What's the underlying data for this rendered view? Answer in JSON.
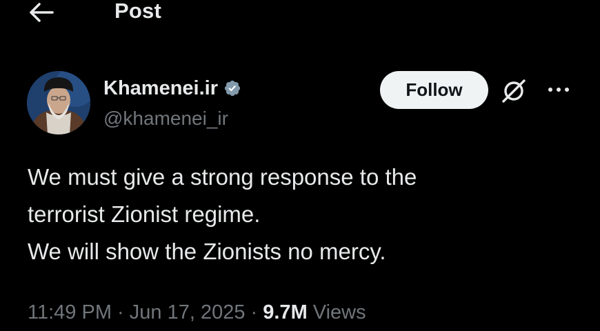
{
  "header": {
    "back_icon": "arrow-left-icon",
    "title": "Post"
  },
  "author": {
    "display_name": "Khamenei.ir",
    "handle": "@khamenei_ir",
    "verified_icon": "verified-badge-icon",
    "verified_color": "#829aab",
    "avatar": "user-avatar"
  },
  "actions": {
    "follow_label": "Follow",
    "grok_icon": "grok-icon",
    "more_icon": "more-dots-icon"
  },
  "tweet": {
    "lines": [
      "We must give a strong response to the",
      "terrorist Zionist regime.",
      "We will show the Zionists no mercy."
    ]
  },
  "meta": {
    "time": "11:49 PM",
    "separator": " · ",
    "date": "Jun 17, 2025",
    "views_count": "9.7M",
    "views_label": " Views"
  },
  "colors": {
    "background": "#000000",
    "text_primary": "#e7e9ea",
    "text_secondary": "#71767b",
    "follow_bg": "#eff3f4",
    "follow_text": "#0f1419"
  }
}
